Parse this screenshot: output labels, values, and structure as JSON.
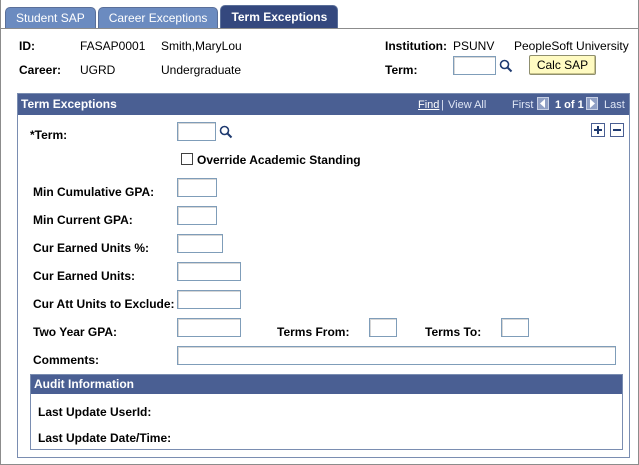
{
  "tabs": [
    {
      "label": "Student SAP",
      "active": false
    },
    {
      "label": "Career Exceptions",
      "active": false
    },
    {
      "label": "Term Exceptions",
      "active": true
    }
  ],
  "header": {
    "id_label": "ID:",
    "id_value": "FASAP0001",
    "name": "Smith,MaryLou",
    "career_label": "Career:",
    "career_code": "UGRD",
    "career_desc": "Undergraduate",
    "institution_label": "Institution:",
    "institution_code": "PSUNV",
    "institution_name": "PeopleSoft University",
    "term_label": "Term:",
    "term_value": "",
    "calc_button": "Calc SAP"
  },
  "term_exceptions": {
    "title": "Term Exceptions",
    "nav": {
      "find": "Find",
      "sep": "|",
      "view_all": "View All",
      "first": "First",
      "position": "1 of 1",
      "last": "Last"
    },
    "term_label": "*Term:",
    "term_value": "",
    "override_label": "Override Academic Standing",
    "override_checked": false,
    "min_cum_gpa_label": "Min Cumulative GPA:",
    "min_cum_gpa_value": "",
    "min_cur_gpa_label": "Min Current GPA:",
    "min_cur_gpa_value": "",
    "cur_earned_pct_label": "Cur Earned Units %:",
    "cur_earned_pct_value": "",
    "cur_earned_label": "Cur Earned Units:",
    "cur_earned_value": "",
    "cur_att_excl_label": "Cur Att Units to Exclude:",
    "cur_att_excl_value": "",
    "two_year_gpa_label": "Two Year GPA:",
    "two_year_gpa_value": "",
    "terms_from_label": "Terms From:",
    "terms_from_value": "",
    "terms_to_label": "Terms To:",
    "terms_to_value": "",
    "comments_label": "Comments:",
    "comments_value": ""
  },
  "audit": {
    "title": "Audit Information",
    "last_update_userid_label": "Last Update UserId:",
    "last_update_userid": "",
    "last_update_dt_label": "Last Update Date/Time:",
    "last_update_dt": ""
  },
  "colors": {
    "tab_active": "#34487e",
    "tab_inactive": "#6b8bc0",
    "section_header": "#4a5f93",
    "calc_button_bg": "#fffbc2"
  }
}
